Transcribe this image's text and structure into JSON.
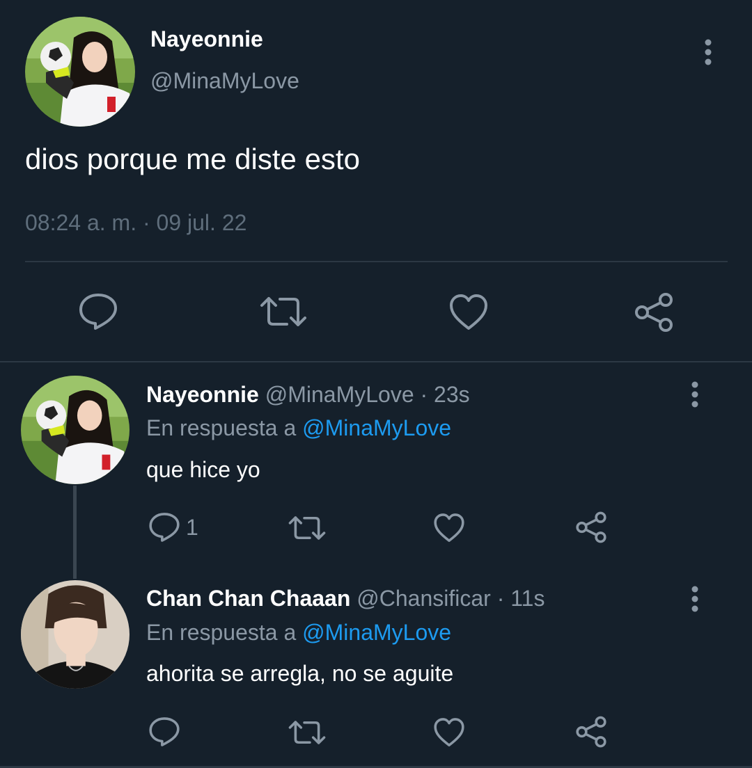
{
  "main_tweet": {
    "display_name": "Nayeonnie",
    "handle": "@MinaMyLove",
    "text": "dios porque me diste esto",
    "timestamp": "08:24 a. m. · 09 jul. 22",
    "actions": [
      "reply-icon",
      "retweet-icon",
      "like-icon",
      "share-icon"
    ]
  },
  "replies": [
    {
      "display_name": "Nayeonnie",
      "handle": "@MinaMyLove",
      "time": "· 23s",
      "reply_to_label": "En respuesta a",
      "reply_to_handle": "@MinaMyLove",
      "text": "que hice yo",
      "reply_count": "1"
    },
    {
      "display_name": "Chan Chan Chaaan",
      "handle": "@Chansificar",
      "time": "· 11s",
      "reply_to_label": "En respuesta a",
      "reply_to_handle": "@MinaMyLove",
      "text": "ahorita se arregla, no se aguite",
      "reply_count": ""
    }
  ],
  "colors": {
    "background": "#15202b",
    "primary_text": "#ffffff",
    "secondary_text": "#8b98a5",
    "link": "#1d9bf0",
    "divider": "#2c3844"
  }
}
